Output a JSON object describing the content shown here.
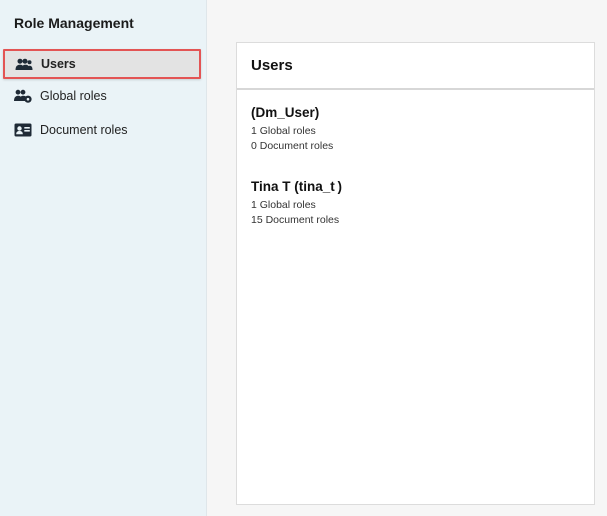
{
  "sidebar": {
    "title": "Role Management",
    "items": [
      {
        "label": "Users",
        "icon": "users-icon",
        "active": true
      },
      {
        "label": "Global roles",
        "icon": "users-gear-icon",
        "active": false
      },
      {
        "label": "Document roles",
        "icon": "id-card-icon",
        "active": false
      }
    ]
  },
  "main": {
    "title": "Users",
    "users": [
      {
        "name": "(Dm_User)",
        "global_roles": "1 Global roles",
        "document_roles": "0 Document roles"
      },
      {
        "name": "Tina T (tina_t )",
        "global_roles": "1 Global roles",
        "document_roles": "15 Document roles"
      }
    ]
  },
  "colors": {
    "sidebar_bg": "#eaf3f7",
    "active_outline": "#e35454",
    "panel_bg": "#ffffff"
  }
}
